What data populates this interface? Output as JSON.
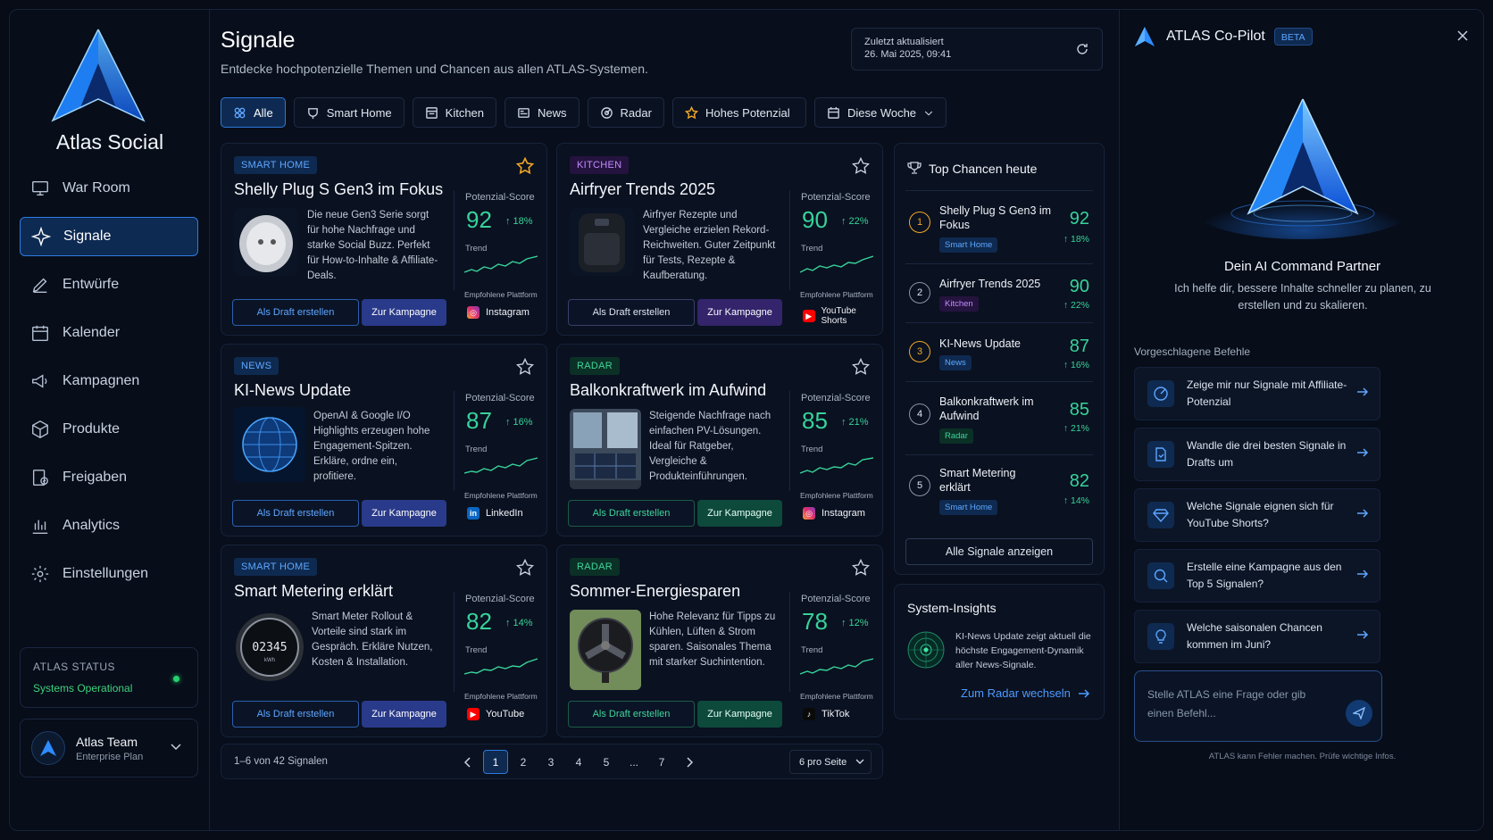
{
  "brand": {
    "name": "Atlas Social"
  },
  "nav": [
    {
      "label": "War Room",
      "icon": "monitor-icon"
    },
    {
      "label": "Signale",
      "icon": "sparkle-icon",
      "active": true
    },
    {
      "label": "Entwürfe",
      "icon": "pen-icon"
    },
    {
      "label": "Kalender",
      "icon": "calendar-icon"
    },
    {
      "label": "Kampagnen",
      "icon": "megaphone-icon"
    },
    {
      "label": "Produkte",
      "icon": "box-icon"
    },
    {
      "label": "Freigaben",
      "icon": "approval-icon"
    },
    {
      "label": "Analytics",
      "icon": "bar-chart-icon"
    },
    {
      "label": "Einstellungen",
      "icon": "gear-icon"
    }
  ],
  "status": {
    "title": "ATLAS STATUS",
    "value": "Systems Operational"
  },
  "team": {
    "name": "Atlas Team",
    "plan": "Enterprise Plan"
  },
  "header": {
    "title": "Signale",
    "subtitle": "Entdecke hochpotenzielle Themen und Chancen aus allen ATLAS-Systemen.",
    "updated_label": "Zuletzt aktualisiert",
    "updated_value": "26. Mai 2025, 09:41"
  },
  "filters": [
    "Alle",
    "Smart Home",
    "Kitchen",
    "News",
    "Radar",
    "Hohes Potenzial",
    "Diese Woche"
  ],
  "labels": {
    "score": "Potenzial-Score",
    "trend": "Trend",
    "platform": "Empfohlene Plattform",
    "draft": "Als Draft erstellen",
    "campaign": "Zur Kampagne"
  },
  "cards": [
    {
      "tag": "SMART HOME",
      "title": "Shelly Plug S Gen3 im Fokus",
      "desc": "Die neue Gen3 Serie sorgt für hohe Nachfrage und starke Social Buzz. Perfekt für How-to-Inhalte & Affiliate-Deals.",
      "score": "92",
      "delta": "↑ 18%",
      "platform": "Instagram",
      "starred": true
    },
    {
      "tag": "KITCHEN",
      "title": "Airfryer Trends 2025",
      "desc": "Airfryer Rezepte und Vergleiche erzielen Rekord-Reichweiten. Guter Zeitpunkt für Tests, Rezepte & Kaufberatung.",
      "score": "90",
      "delta": "↑ 22%",
      "platform": "YouTube Shorts",
      "starred": false
    },
    {
      "tag": "NEWS",
      "title": "KI-News Update",
      "desc": "OpenAI & Google I/O Highlights erzeugen hohe Engagement-Spitzen. Erkläre, ordne ein, profitiere.",
      "score": "87",
      "delta": "↑ 16%",
      "platform": "LinkedIn",
      "starred": false
    },
    {
      "tag": "RADAR",
      "title": "Balkonkraftwerk im Aufwind",
      "desc": "Steigende Nachfrage nach einfachen PV-Lösungen. Ideal für Ratgeber, Vergleiche & Produkteinführungen.",
      "score": "85",
      "delta": "↑ 21%",
      "platform": "Instagram",
      "starred": false
    },
    {
      "tag": "SMART HOME",
      "title": "Smart Metering erklärt",
      "desc": "Smart Meter Rollout & Vorteile sind stark im Gespräch. Erkläre Nutzen, Kosten & Installation.",
      "score": "82",
      "delta": "↑ 14%",
      "platform": "YouTube",
      "starred": false
    },
    {
      "tag": "RADAR",
      "title": "Sommer-Energiesparen",
      "desc": "Hohe Relevanz für Tipps zu Kühlen, Lüften & Strom sparen. Saisonales Thema mit starker Suchintention.",
      "score": "78",
      "delta": "↑ 12%",
      "platform": "TikTok",
      "starred": false
    }
  ],
  "meter_reading": {
    "value": "02345",
    "unit": "kWh"
  },
  "pagination": {
    "info": "1–6 von 42 Signalen",
    "pages": [
      "1",
      "2",
      "3",
      "4",
      "5",
      "...",
      "7"
    ],
    "per_page": "6 pro Seite"
  },
  "top": {
    "title": "Top Chancen heute",
    "items": [
      {
        "rank": "1",
        "name": "Shelly Plug S Gen3 im Fokus",
        "tag": "Smart Home",
        "score": "92",
        "delta": "↑ 18%"
      },
      {
        "rank": "2",
        "name": "Airfryer Trends 2025",
        "tag": "Kitchen",
        "score": "90",
        "delta": "↑ 22%"
      },
      {
        "rank": "3",
        "name": "KI-News Update",
        "tag": "News",
        "score": "87",
        "delta": "↑ 16%"
      },
      {
        "rank": "4",
        "name": "Balkonkraftwerk im Aufwind",
        "tag": "Radar",
        "score": "85",
        "delta": "↑ 21%"
      },
      {
        "rank": "5",
        "name": "Smart Metering erklärt",
        "tag": "Smart Home",
        "score": "82",
        "delta": "↑ 14%"
      }
    ],
    "all": "Alle Signale anzeigen"
  },
  "insights": {
    "title": "System-Insights",
    "text": "KI-News Update zeigt aktuell die höchste Engagement-Dynamik aller News-Signale.",
    "link": "Zum Radar wechseln"
  },
  "copilot": {
    "title": "ATLAS Co-Pilot",
    "beta": "BETA",
    "hero_title": "Dein AI Command Partner",
    "hero_sub": "Ich helfe dir, bessere Inhalte schneller zu planen, zu erstellen und zu skalieren.",
    "commands_label": "Vorgeschlagene Befehle",
    "commands": [
      "Zeige mir nur Signale mit Affiliate-Potenzial",
      "Wandle die drei besten Signale in Drafts um",
      "Welche Signale eignen sich für YouTube Shorts?",
      "Erstelle eine Kampagne aus den Top 5 Signalen?",
      "Welche saisonalen Chancen kommen im Juni?"
    ],
    "placeholder": "Stelle ATLAS eine Frage oder gib einen Befehl...",
    "disclaimer": "ATLAS kann Fehler machen. Prüfe wichtige Infos."
  },
  "colors": {
    "accent": "#2f7be0",
    "positive": "#37d39a",
    "warning": "#f0a727"
  }
}
